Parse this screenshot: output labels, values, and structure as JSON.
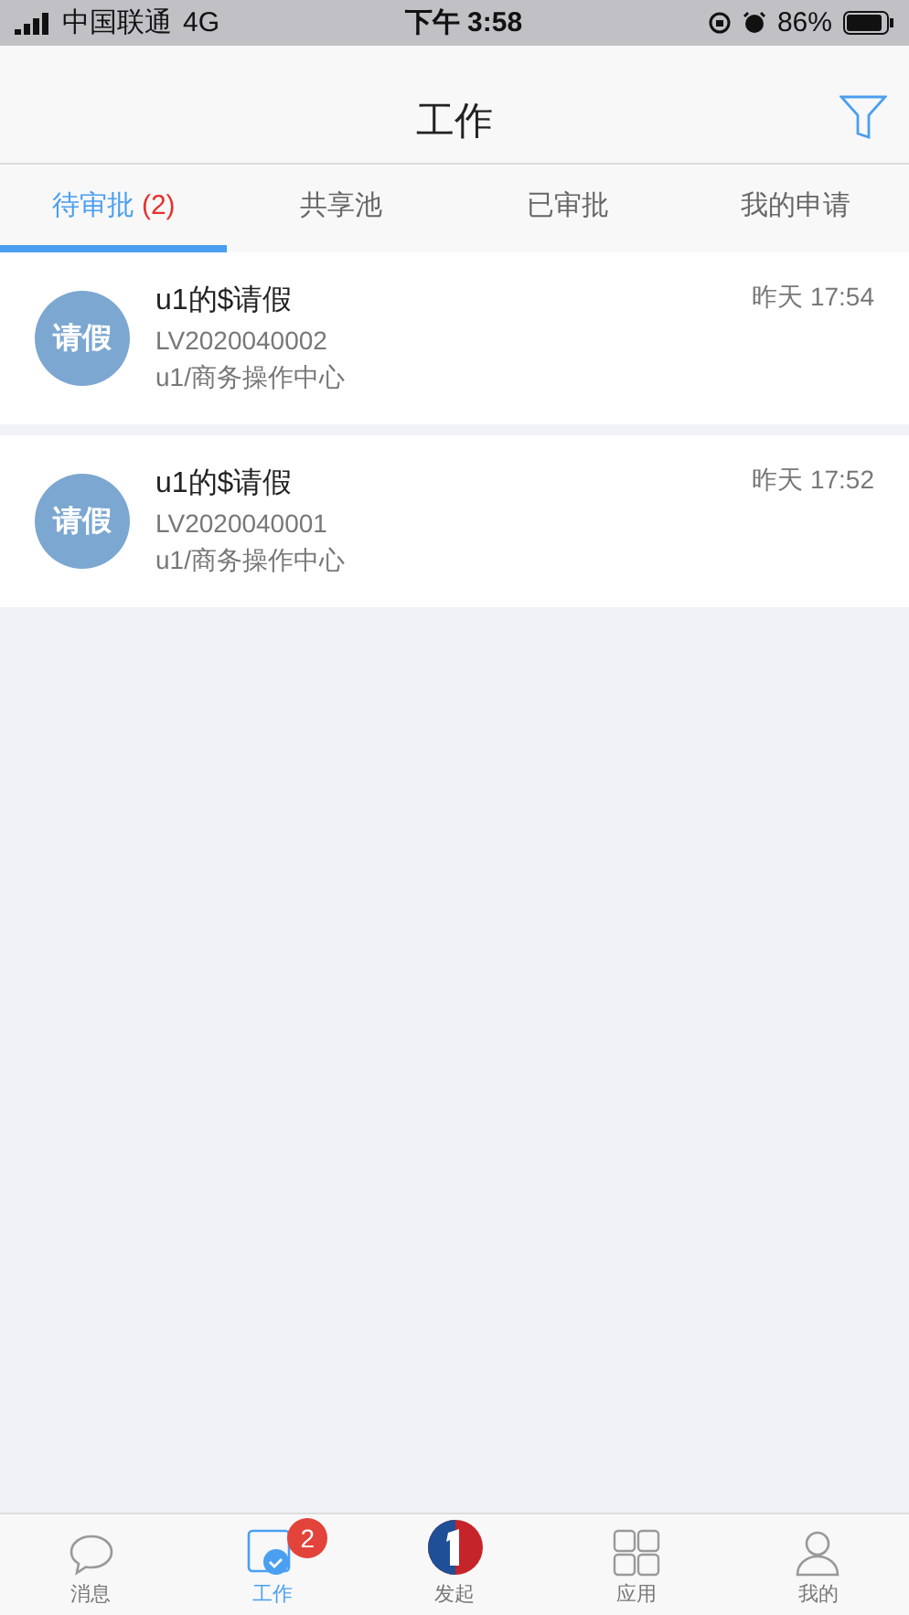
{
  "status_bar": {
    "carrier": "中国联通",
    "network": "4G",
    "time": "下午 3:58",
    "battery": "86%"
  },
  "header": {
    "title": "工作"
  },
  "tabs": [
    {
      "label": "待审批",
      "count": "(2)",
      "selected": true
    },
    {
      "label": "共享池",
      "selected": false
    },
    {
      "label": "已审批",
      "selected": false
    },
    {
      "label": "我的申请",
      "selected": false
    }
  ],
  "items": [
    {
      "avatar": "请假",
      "title": "u1的$请假",
      "code": "LV2020040002",
      "dept": "u1/商务操作中心",
      "time": "昨天 17:54"
    },
    {
      "avatar": "请假",
      "title": "u1的$请假",
      "code": "LV2020040001",
      "dept": "u1/商务操作中心",
      "time": "昨天 17:52"
    }
  ],
  "bottom_nav": [
    {
      "kind": "chat",
      "label": "消息",
      "selected": false
    },
    {
      "kind": "work",
      "label": "工作",
      "selected": true,
      "badge": "2"
    },
    {
      "kind": "launch",
      "label": "发起",
      "selected": false
    },
    {
      "kind": "apps",
      "label": "应用",
      "selected": false
    },
    {
      "kind": "profile",
      "label": "我的",
      "selected": false
    }
  ]
}
